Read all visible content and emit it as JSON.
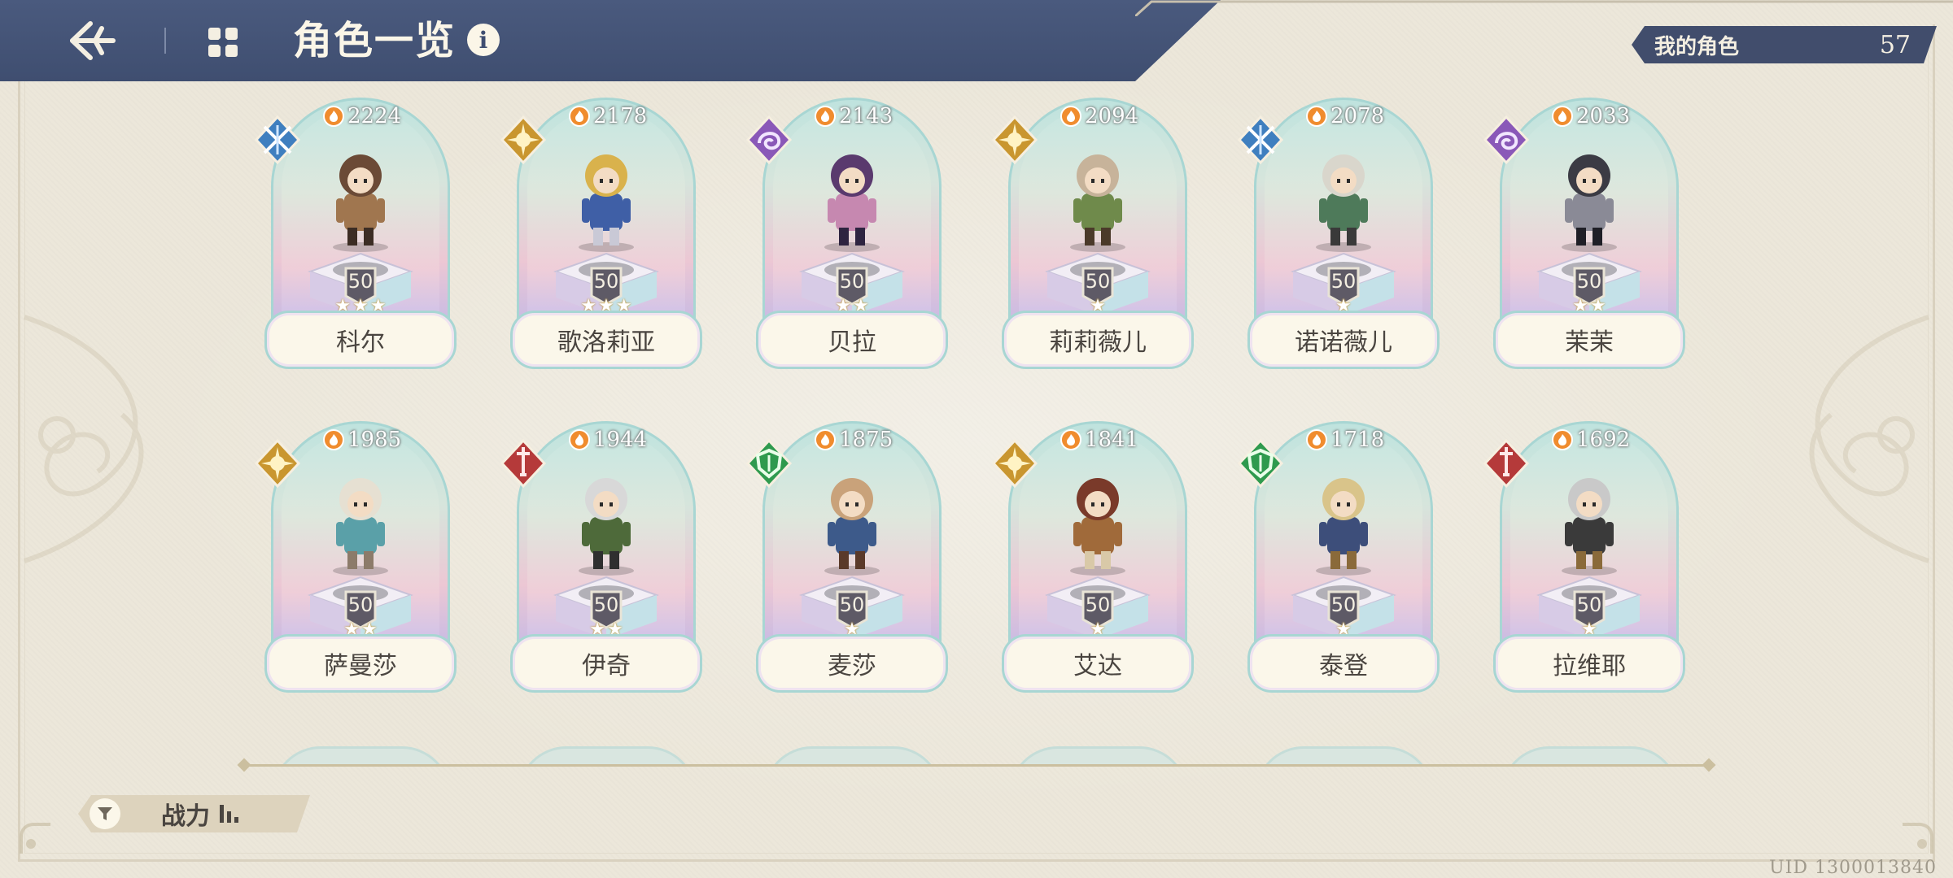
{
  "header": {
    "title": "角色一览",
    "info_label": "i"
  },
  "owned": {
    "label": "我的角色",
    "count": "57"
  },
  "characters": [
    {
      "name": "科尔",
      "power": "2224",
      "level": "50",
      "stars": 3,
      "element": "blue-wind"
    },
    {
      "name": "歌洛莉亚",
      "power": "2178",
      "level": "50",
      "stars": 3,
      "element": "gold-sun"
    },
    {
      "name": "贝拉",
      "power": "2143",
      "level": "50",
      "stars": 2,
      "element": "purple-void"
    },
    {
      "name": "莉莉薇儿",
      "power": "2094",
      "level": "50",
      "stars": 1,
      "element": "gold-sun"
    },
    {
      "name": "诺诺薇儿",
      "power": "2078",
      "level": "50",
      "stars": 1,
      "element": "blue-wind"
    },
    {
      "name": "茉茉",
      "power": "2033",
      "level": "50",
      "stars": 2,
      "element": "purple-void"
    },
    {
      "name": "萨曼莎",
      "power": "1985",
      "level": "50",
      "stars": 2,
      "element": "gold-sun"
    },
    {
      "name": "伊奇",
      "power": "1944",
      "level": "50",
      "stars": 2,
      "element": "red-blade"
    },
    {
      "name": "麦莎",
      "power": "1875",
      "level": "50",
      "stars": 1,
      "element": "green-shield"
    },
    {
      "name": "艾达",
      "power": "1841",
      "level": "50",
      "stars": 1,
      "element": "gold-sun"
    },
    {
      "name": "泰登",
      "power": "1718",
      "level": "50",
      "stars": 1,
      "element": "green-shield"
    },
    {
      "name": "拉维耶",
      "power": "1692",
      "level": "50",
      "stars": 1,
      "element": "red-blade"
    }
  ],
  "element_colors": {
    "blue-wind": "#3f7fbf",
    "gold-sun": "#c9962f",
    "purple-void": "#8a58b8",
    "green-shield": "#2f9a4e",
    "red-blade": "#b53a3a"
  },
  "sort": {
    "label": "战力"
  },
  "uid": "UID 1300013840"
}
